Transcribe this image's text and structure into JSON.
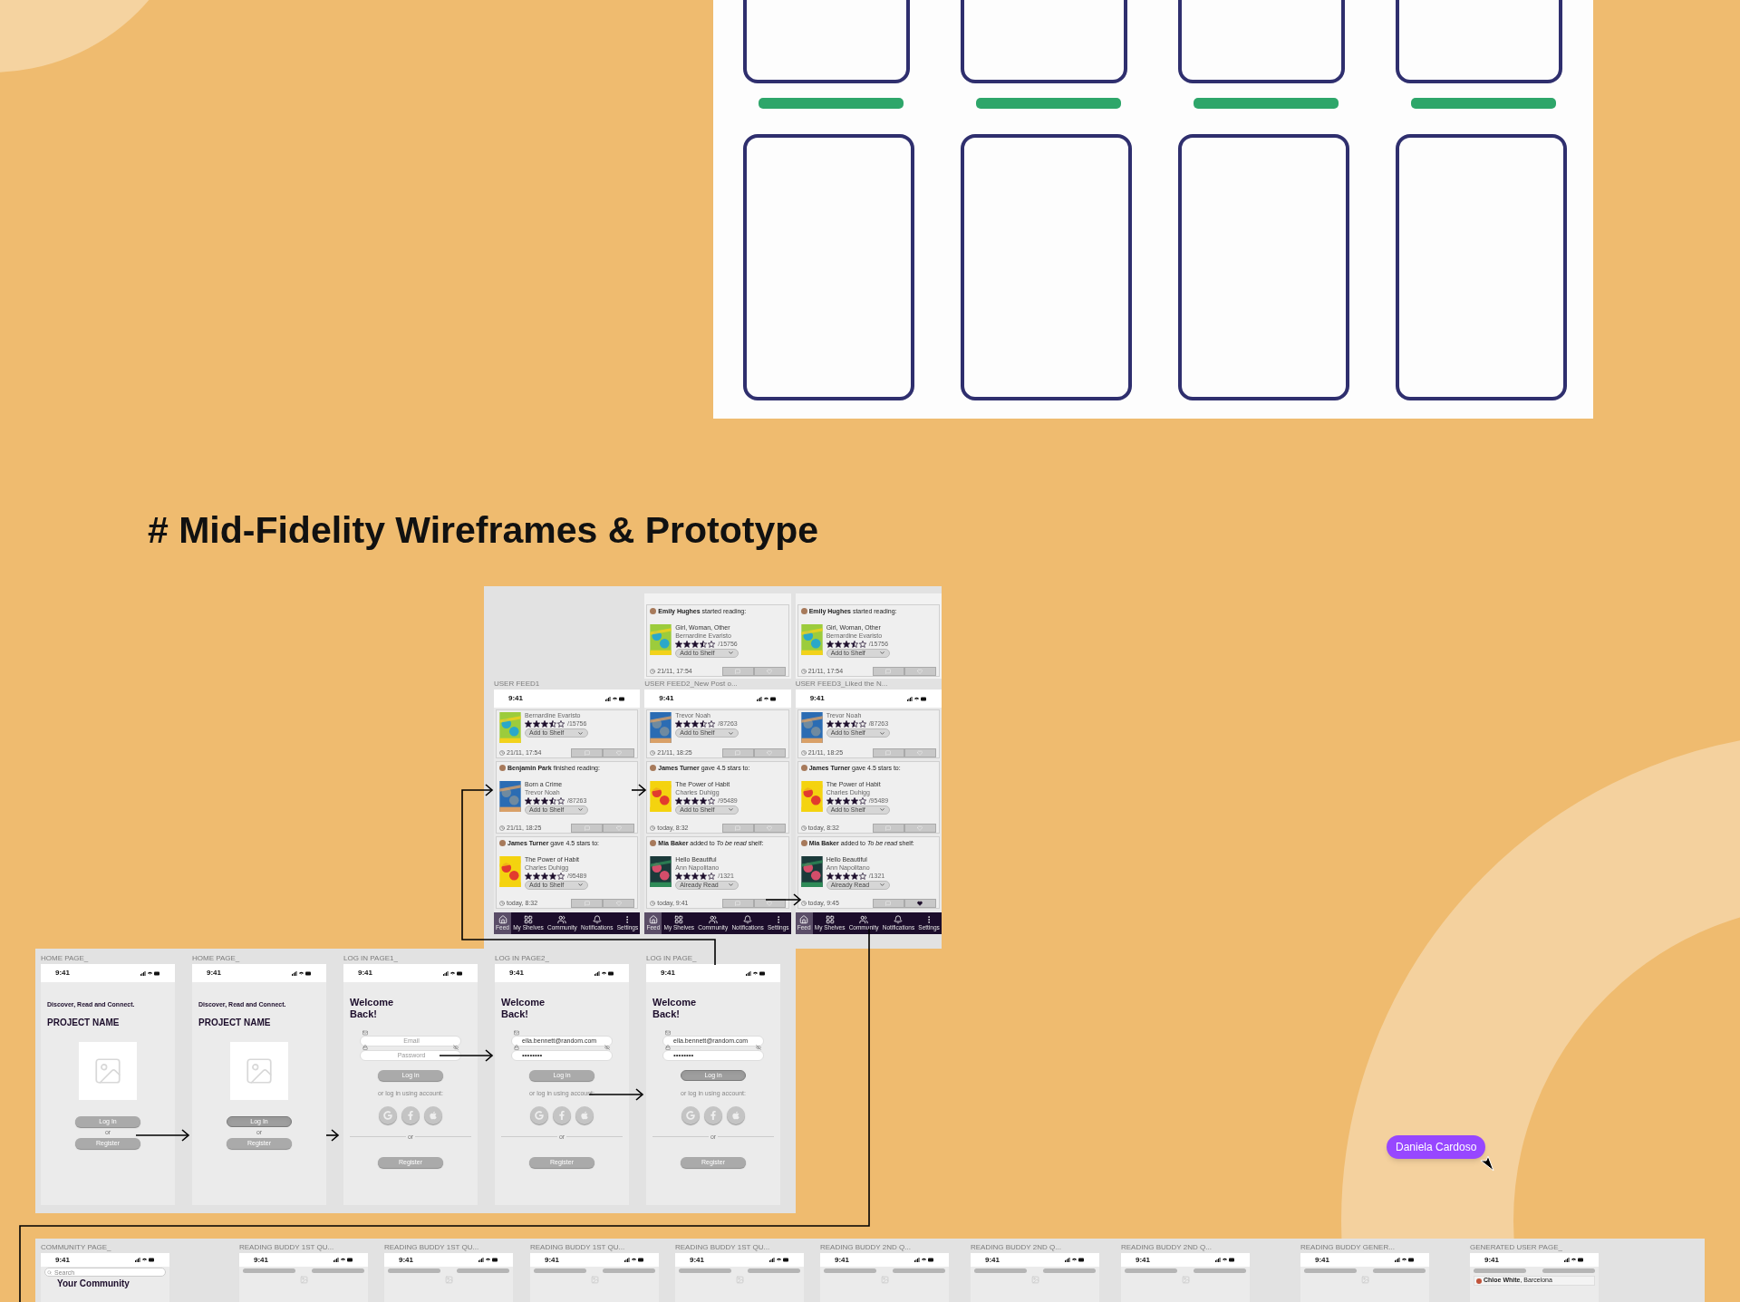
{
  "heading": "# Mid-Fidelity Wireframes & Prototype",
  "feed_frames": [
    {
      "label": "USER FEED1",
      "time": "9:41",
      "posts": [
        {
          "kind": "partial",
          "author": "Bernardine Evaristo",
          "stars": 3.5,
          "ratings": "/15756",
          "shelf": "Add to Shelf",
          "time": "21/11, 17:54",
          "liked": false
        },
        {
          "kind": "full",
          "headline": "**Benjamin Park** finished reading:",
          "title": "Born a Crime",
          "author": "Trevor Noah",
          "stars": 3.5,
          "ratings": "/87263",
          "shelf": "Add to Shelf",
          "time": "21/11, 18:25",
          "liked": false
        },
        {
          "kind": "full",
          "headline": "**James Turner** gave 4.5 stars to:",
          "title": "The Power of Habit",
          "author": "Charles Duhigg",
          "stars": 4,
          "ratings": "/95489",
          "shelf": "Add to Shelf",
          "time": "today, 8:32",
          "liked": false
        }
      ],
      "nav": [
        {
          "label": "Feed",
          "selected": true
        },
        {
          "label": "My Shelves",
          "selected": false
        },
        {
          "label": "Community",
          "selected": false
        },
        {
          "label": "Notifications",
          "selected": false
        },
        {
          "label": "Settings",
          "selected": false
        }
      ]
    },
    {
      "label": "USER FEED2_New Post o...",
      "time": "9:41",
      "top_post": {
        "kind": "full",
        "headline": "**Emily Hughes** started reading:",
        "title": "Girl, Woman, Other",
        "author": "Bernardine Evaristo",
        "stars": 3.5,
        "ratings": "/15756",
        "shelf": "Add to Shelf",
        "time": "21/11, 17:54",
        "liked": false
      },
      "posts": [
        {
          "kind": "partial",
          "author": "Trevor Noah",
          "stars": 3.5,
          "ratings": "/87263",
          "shelf": "Add to Shelf",
          "time": "21/11, 18:25",
          "liked": false
        },
        {
          "kind": "full",
          "headline": "**James Turner** gave 4.5 stars to:",
          "title": "The Power of Habit",
          "author": "Charles Duhigg",
          "stars": 4,
          "ratings": "/95489",
          "shelf": "Add to Shelf",
          "time": "today, 8:32",
          "liked": false
        },
        {
          "kind": "full",
          "headline": "**Mia Baker** added to *To be read* shelf:",
          "title": "Hello Beautiful",
          "author": "Ann Napolitano",
          "stars": 4,
          "ratings": "/1321",
          "shelf": "Already Read",
          "time": "today, 9:41",
          "liked": false
        }
      ],
      "nav": [
        {
          "label": "Feed",
          "selected": true
        },
        {
          "label": "My Shelves",
          "selected": false
        },
        {
          "label": "Community",
          "selected": false
        },
        {
          "label": "Notifications",
          "selected": false
        },
        {
          "label": "Settings",
          "selected": false
        }
      ]
    },
    {
      "label": "USER FEED3_Liked the N...",
      "time": "9:41",
      "top_post": {
        "kind": "full",
        "headline": "**Emily Hughes** started reading:",
        "title": "Girl, Woman, Other",
        "author": "Bernardine Evaristo",
        "stars": 3.5,
        "ratings": "/15756",
        "shelf": "Add to Shelf",
        "time": "21/11, 17:54",
        "liked": false
      },
      "posts": [
        {
          "kind": "partial",
          "author": "Trevor Noah",
          "stars": 3.5,
          "ratings": "/87263",
          "shelf": "Add to Shelf",
          "time": "21/11, 18:25",
          "liked": false
        },
        {
          "kind": "full",
          "headline": "**James Turner** gave 4.5 stars to:",
          "title": "The Power of Habit",
          "author": "Charles Duhigg",
          "stars": 4,
          "ratings": "/95489",
          "shelf": "Add to Shelf",
          "time": "today, 8:32",
          "liked": false
        },
        {
          "kind": "full",
          "headline": "**Mia Baker** added to *To be read* shelf:",
          "title": "Hello Beautiful",
          "author": "Ann Napolitano",
          "stars": 4,
          "ratings": "/1321",
          "shelf": "Already Read",
          "time": "today, 9:45",
          "liked": true
        }
      ],
      "nav": [
        {
          "label": "Feed",
          "selected": true
        },
        {
          "label": "My Shelves",
          "selected": false
        },
        {
          "label": "Community",
          "selected": false
        },
        {
          "label": "Notifications",
          "selected": false
        },
        {
          "label": "Settings",
          "selected": false
        }
      ]
    }
  ],
  "start_frames": [
    {
      "kind": "home",
      "label": "HOME PAGE_",
      "time": "9:41",
      "tagline": "Discover, Read and Connect.",
      "title": "PROJECT NAME",
      "login": {
        "label": "Log In",
        "pressed": false
      },
      "or": "or",
      "register": "Register"
    },
    {
      "kind": "home",
      "label": "HOME PAGE_",
      "time": "9:41",
      "tagline": "Discover, Read and Connect.",
      "title": "PROJECT NAME",
      "login": {
        "label": "Log In",
        "pressed": true
      },
      "or": "or",
      "register": "Register"
    },
    {
      "kind": "login",
      "label": "LOG IN PAGE1_",
      "time": "9:41",
      "heading": "Welcome Back!",
      "email": {
        "placeholder": "Email"
      },
      "password": {
        "placeholder": "Password"
      },
      "login": {
        "label": "Log in",
        "pressed": false
      },
      "alt": "or log in using account:",
      "or": "or",
      "register": "Register"
    },
    {
      "kind": "login",
      "label": "LOG IN PAGE2_",
      "time": "9:41",
      "heading": "Welcome Back!",
      "email": {
        "value": "ella.bennett@random.com"
      },
      "password": {
        "value": "••••••••"
      },
      "login": {
        "label": "Log in",
        "pressed": false
      },
      "alt": "or log in using account:",
      "or": "or",
      "register": "Register"
    },
    {
      "kind": "login",
      "label": "LOG IN PAGE_",
      "time": "9:41",
      "heading": "Welcome Back!",
      "email": {
        "value": "ella.bennett@random.com"
      },
      "password": {
        "value": "••••••••"
      },
      "login": {
        "label": "Log in",
        "pressed": true
      },
      "alt": "or log in using account:",
      "or": "or",
      "register": "Register"
    }
  ],
  "flow_frames": [
    {
      "kind": "community",
      "label": "COMMUNITY PAGE_",
      "time": "9:41",
      "search": {
        "placeholder": "Search"
      },
      "title": "Your Community"
    },
    {
      "kind": "quiz",
      "label": "READING BUDDY 1ST QU...",
      "time": "9:41"
    },
    {
      "kind": "quiz",
      "label": "READING BUDDY 1ST QU...",
      "time": "9:41"
    },
    {
      "kind": "quiz",
      "label": "READING BUDDY 1ST QU...",
      "time": "9:41"
    },
    {
      "kind": "quiz",
      "label": "READING BUDDY 1ST QU...",
      "time": "9:41"
    },
    {
      "kind": "quiz",
      "label": "READING BUDDY 2ND Q...",
      "time": "9:41"
    },
    {
      "kind": "quiz",
      "label": "READING BUDDY 2ND Q...",
      "time": "9:41"
    },
    {
      "kind": "quiz",
      "label": "READING BUDDY 2ND Q...",
      "time": "9:41"
    },
    {
      "kind": "quiz",
      "label": "READING BUDDY GENER...",
      "time": "9:41"
    },
    {
      "kind": "profile",
      "label": "GENERATED USER PAGE_",
      "time": "9:41",
      "user": "**Chloe White**, Barcelona"
    }
  ],
  "collaborator": {
    "name": "Daniela Cardoso"
  }
}
